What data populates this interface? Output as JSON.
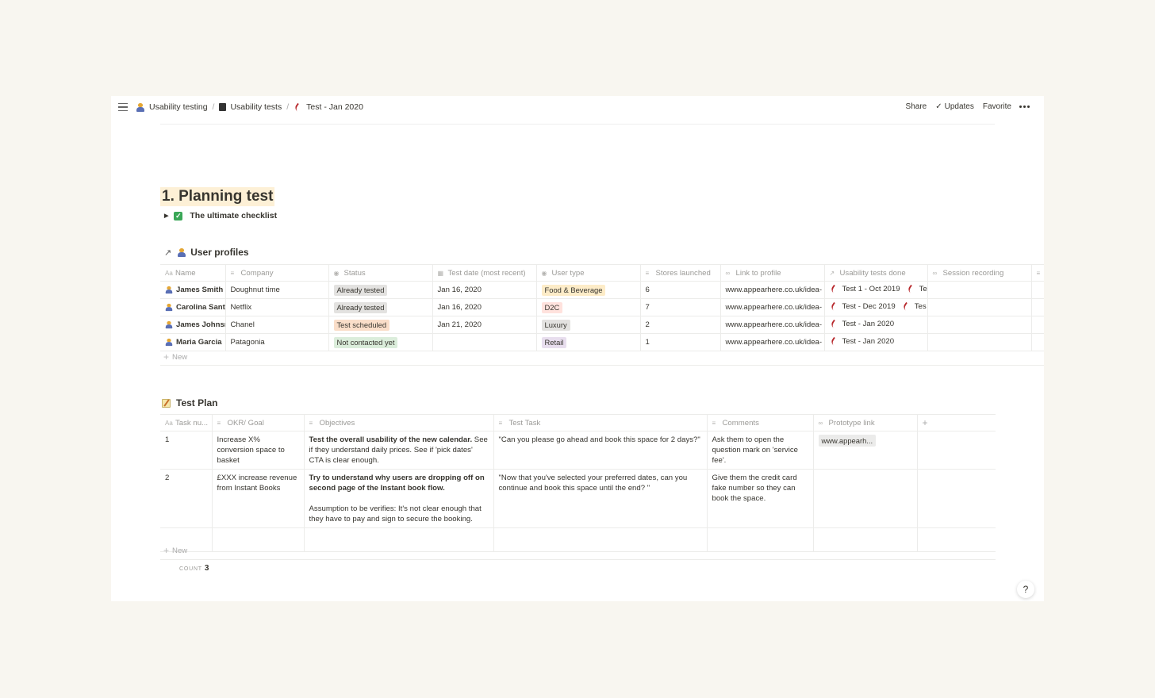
{
  "breadcrumb": [
    {
      "label": "Usability testing",
      "icon": "person-icon"
    },
    {
      "label": "Usability tests",
      "icon": "book-icon"
    },
    {
      "label": "Test - Jan 2020",
      "icon": "chili-icon"
    }
  ],
  "topbar": {
    "share": "Share",
    "updates": "Updates",
    "favorite": "Favorite"
  },
  "page": {
    "heading": "1. Planning test",
    "toggle_label": "The ultimate checklist"
  },
  "user_profiles": {
    "title": "User profiles",
    "columns": [
      "Name",
      "Company",
      "Status",
      "Test date (most recent)",
      "User type",
      "Stores launched",
      "Link to profile",
      "Usability tests done",
      "Session recording"
    ],
    "rows": [
      {
        "name": "James Smith",
        "company": "Doughnut time",
        "status": "Already tested",
        "date": "Jan 16, 2020",
        "user_type": "Food & Beverage",
        "stores": "6",
        "link": "www.appearhere.co.uk/idea-",
        "tests": [
          "Test 1 - Oct 2019",
          "Te"
        ]
      },
      {
        "name": "Carolina Sant",
        "company": "Netflix",
        "status": "Already tested",
        "date": "Jan 16, 2020",
        "user_type": "D2C",
        "stores": "7",
        "link": "www.appearhere.co.uk/idea-",
        "tests": [
          "Test - Dec 2019",
          "Tes"
        ]
      },
      {
        "name": "James Johnsı",
        "company": "Chanel",
        "status": "Test scheduled",
        "date": "Jan 21, 2020",
        "user_type": "Luxury",
        "stores": "2",
        "link": "www.appearhere.co.uk/idea-",
        "tests": [
          "Test - Jan 2020"
        ]
      },
      {
        "name": "Maria Garcia",
        "company": "Patagonia",
        "status": "Not contacted yet",
        "date": "",
        "user_type": "Retail",
        "stores": "1",
        "link": "www.appearhere.co.uk/idea-",
        "tests": [
          "Test - Jan 2020"
        ]
      }
    ],
    "new_label": "New"
  },
  "test_plan": {
    "title": "Test Plan",
    "columns": [
      "Task nu...",
      "OKR/ Goal",
      "Objectives",
      "Test Task",
      "Comments",
      "Prototype link"
    ],
    "rows": [
      {
        "num": "1",
        "goal": "Increase X% conversion space to basket",
        "objective_bold": "Test the overall usability of the new calendar.",
        "objective_rest": "See if they understand daily prices. See if 'pick dates' CTA is clear enough.",
        "objective_extra": "",
        "task": "\"Can you please go ahead and book this space for 2 days?\"",
        "comments": "Ask them to open the question mark on 'service fee'.",
        "prototype": "www.appearh..."
      },
      {
        "num": "2",
        "goal": "£XXX increase revenue from Instant Books",
        "objective_bold": "Try to understand why users are dropping off on second page of the Instant book flow.",
        "objective_rest": "",
        "objective_extra": "Assumption to be verifies: It's not clear enough that they have to pay and sign to secure the booking.",
        "task": "\"Now that you've selected your preferred dates, can you continue and book this space until the end? \"",
        "comments": "Give them the credit card fake number so they can book the space.",
        "prototype": ""
      }
    ],
    "new_label": "New",
    "count_label": "COUNT",
    "count_value": "3"
  },
  "help_label": "?",
  "colors": {
    "already_tested": "#e3e2e0",
    "test_scheduled": "#fadec9",
    "not_contacted": "#dbeddb",
    "food_beverage": "#fdecc8",
    "d2c": "#ffe2dd",
    "luxury": "#e3e2e0",
    "retail": "#e8deee",
    "heading_highlight": "#fdf0d6"
  }
}
